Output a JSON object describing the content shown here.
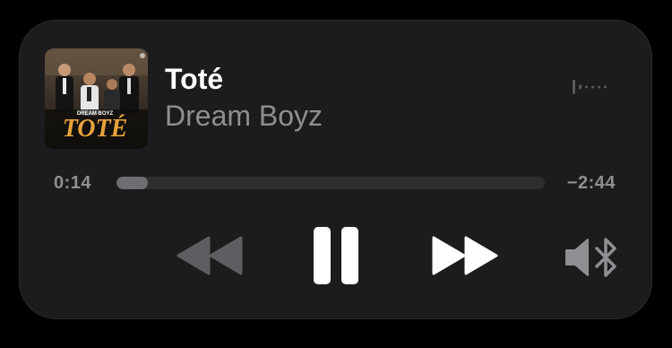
{
  "now_playing": {
    "title": "Toté",
    "artist": "Dream Boyz",
    "artwork_text": "TOTÉ",
    "artwork_logo": "DREAM BOYZ"
  },
  "playback": {
    "elapsed": "0:14",
    "remaining": "−2:44",
    "progress_fraction": 0.074,
    "state": "playing"
  },
  "controls": {
    "rewind_icon": "rewind-icon",
    "pause_icon": "pause-icon",
    "forward_icon": "fast-forward-icon",
    "output_icon": "speaker-bluetooth-icon",
    "waveform_icon": "waveform-icon"
  },
  "colors": {
    "background": "#1c1c1e",
    "title": "#ffffff",
    "secondary": "#8e8e93",
    "track": "#2e2e30",
    "fill": "#6e6e73",
    "artwork_accent": "#e8a33c"
  }
}
